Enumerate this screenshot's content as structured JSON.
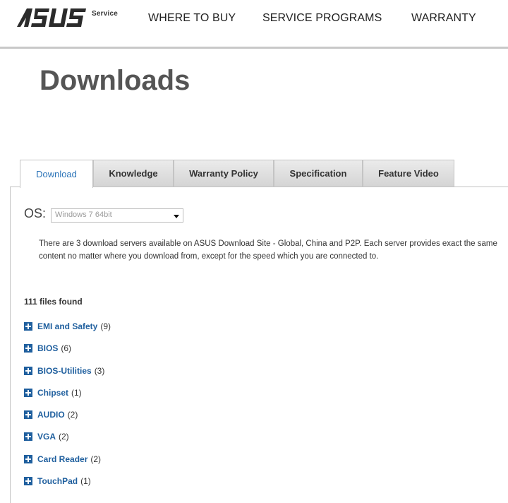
{
  "header": {
    "logo_text": "ASUS",
    "logo_suffix": "Service",
    "nav": [
      {
        "label": "WHERE TO BUY"
      },
      {
        "label": "SERVICE PROGRAMS"
      },
      {
        "label": "WARRANTY"
      }
    ]
  },
  "page": {
    "title": "Downloads"
  },
  "tabs": [
    {
      "label": "Download",
      "active": true
    },
    {
      "label": "Knowledge",
      "active": false
    },
    {
      "label": "Warranty Policy",
      "active": false
    },
    {
      "label": "Specification",
      "active": false
    },
    {
      "label": "Feature Video",
      "active": false
    }
  ],
  "os": {
    "label": "OS:",
    "selected": "Windows 7 64bit"
  },
  "notice": "There are 3 download servers available on ASUS Download Site - Global, China and P2P. Each server provides exact the same content no matter where you download from, except for the speed which you are connected to.",
  "files_found": "111 files found",
  "categories": [
    {
      "name": "EMI and Safety",
      "count": "(9)"
    },
    {
      "name": "BIOS",
      "count": "(6)"
    },
    {
      "name": "BIOS-Utilities",
      "count": "(3)"
    },
    {
      "name": "Chipset",
      "count": "(1)"
    },
    {
      "name": "AUDIO",
      "count": "(2)"
    },
    {
      "name": "VGA",
      "count": "(2)"
    },
    {
      "name": "Card Reader",
      "count": "(2)"
    },
    {
      "name": "TouchPad",
      "count": "(1)"
    }
  ],
  "colors": {
    "link_blue": "#1f5f9e",
    "active_tab_text": "#2a73b8",
    "title_gray": "#555555"
  }
}
